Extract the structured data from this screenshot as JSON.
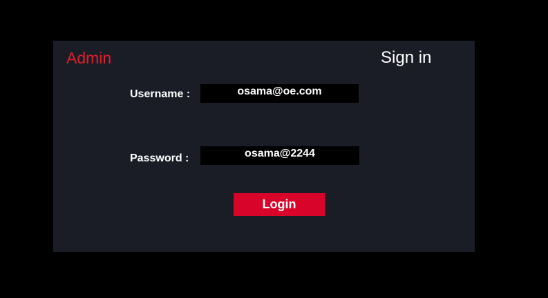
{
  "header": {
    "brand": "Admin",
    "title": "Sign in"
  },
  "form": {
    "username_label": "Username :",
    "username_value": "osama@oe.com",
    "password_label": "Password :",
    "password_value": "osama@2244",
    "login_label": "Login"
  },
  "colors": {
    "page_background": "#000000",
    "panel_background": "#1b1d26",
    "brand_text": "#e01e2c",
    "field_background": "#000000",
    "button_background": "#d90429",
    "text": "#ffffff"
  }
}
